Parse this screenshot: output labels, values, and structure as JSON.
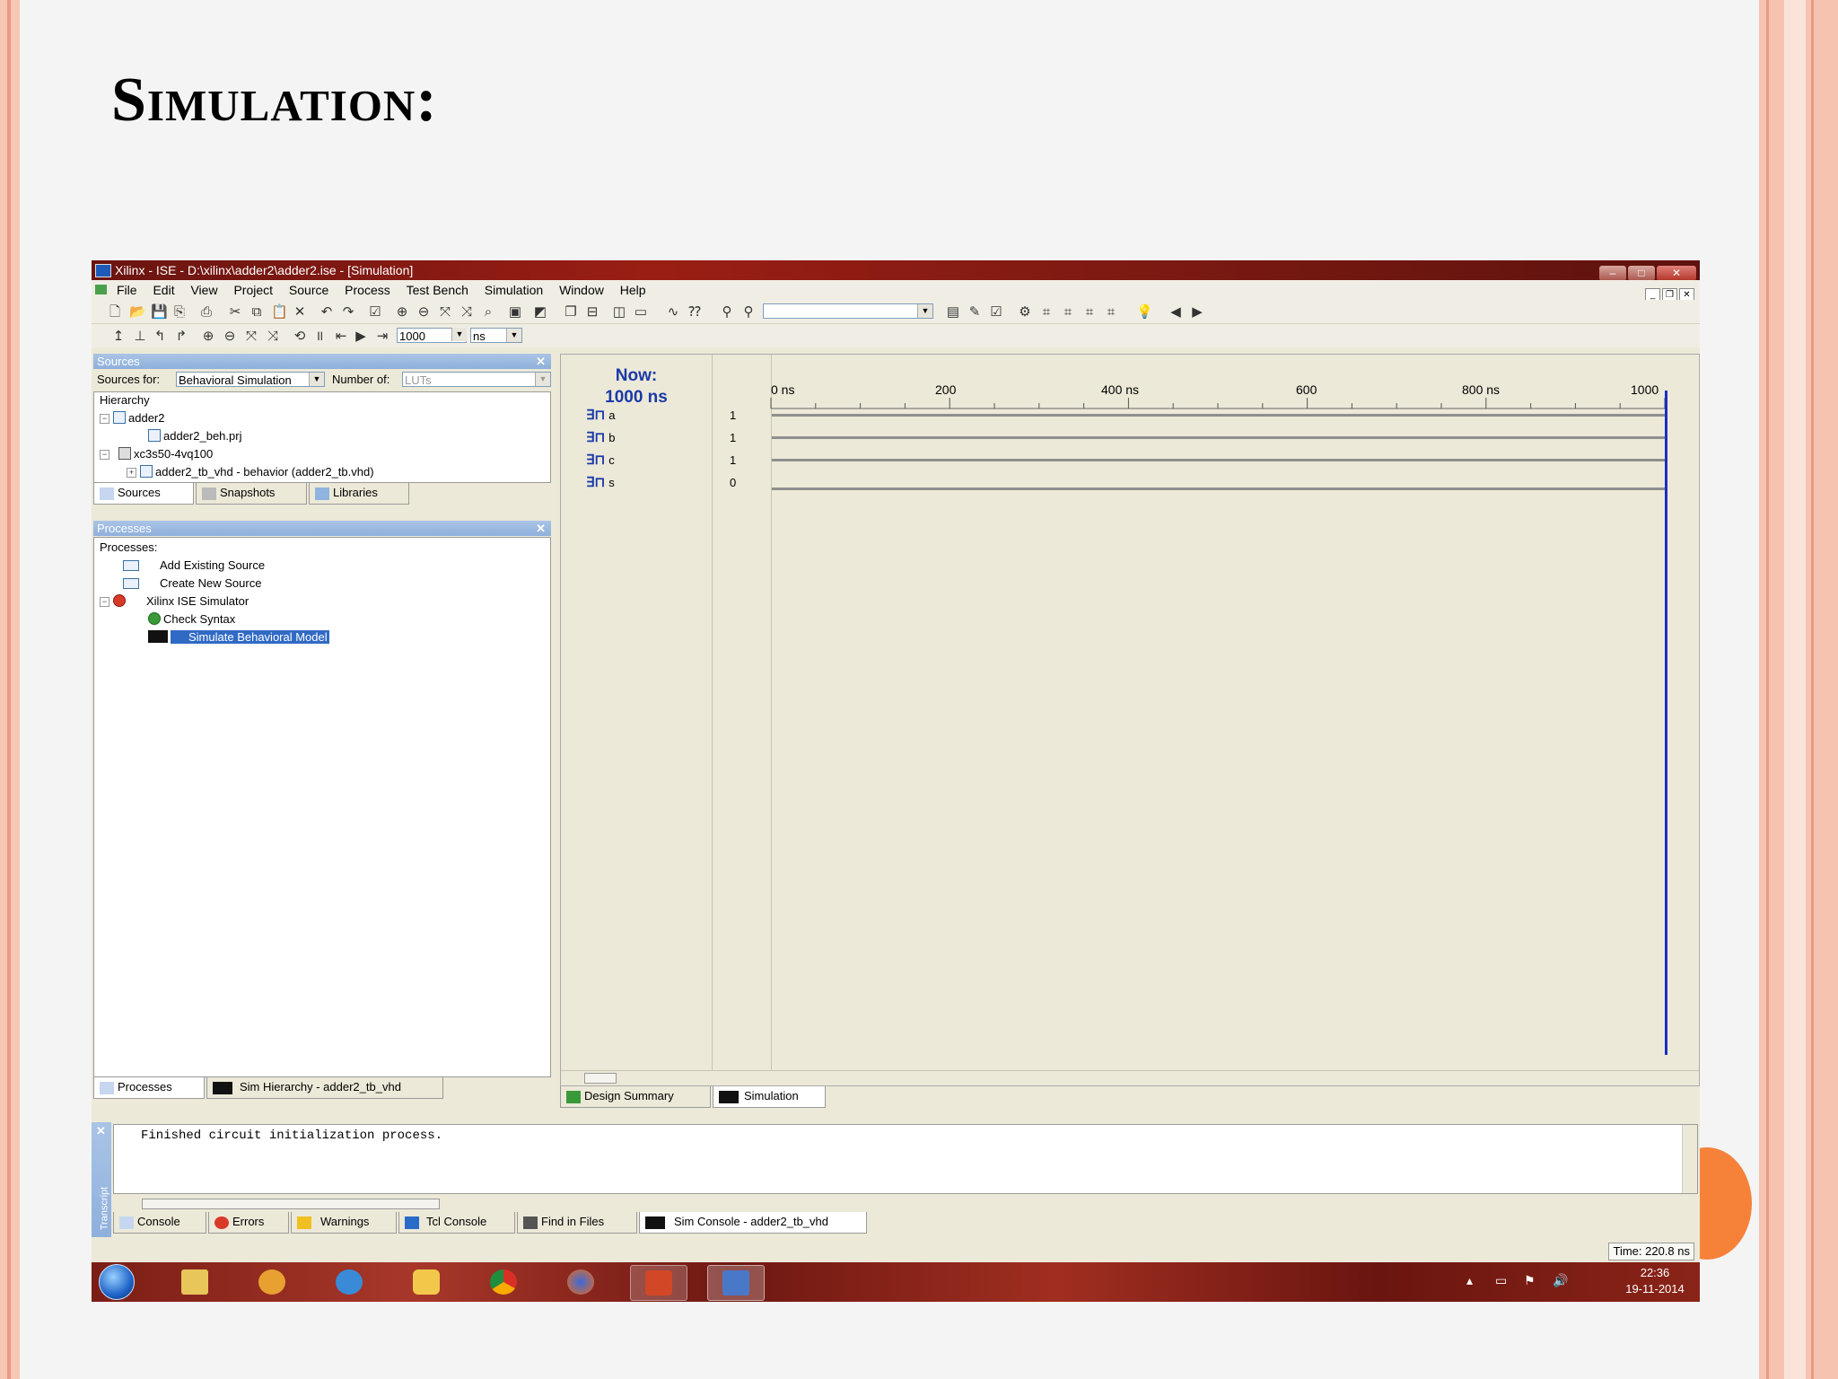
{
  "slide": {
    "title": "Simulation:"
  },
  "window": {
    "title": "Xilinx - ISE - D:\\xilinx\\adder2\\adder2.ise - [Simulation]",
    "controls": {
      "minimize": "–",
      "maximize": "□",
      "close": "✕"
    }
  },
  "menubar": {
    "items": [
      "File",
      "Edit",
      "View",
      "Project",
      "Source",
      "Process",
      "Test Bench",
      "Simulation",
      "Window",
      "Help"
    ]
  },
  "toolbar2": {
    "time_value": "1000",
    "time_unit": "ns"
  },
  "sources_panel": {
    "header": "Sources",
    "sources_for_label": "Sources for:",
    "sources_for_value": "Behavioral Simulation",
    "number_of_label": "Number of:",
    "number_of_value": "LUTs",
    "hierarchy_label": "Hierarchy",
    "tree": [
      {
        "label": "adder2",
        "expander": "−"
      },
      {
        "label": "adder2_beh.prj"
      },
      {
        "label": "xc3s50-4vq100",
        "expander": "−"
      },
      {
        "label": "adder2_tb_vhd - behavior (adder2_tb.vhd)",
        "expander": "+"
      }
    ],
    "tabs": [
      "Sources",
      "Snapshots",
      "Libraries"
    ]
  },
  "processes_panel": {
    "header": "Processes",
    "label": "Processes:",
    "items": [
      "Add Existing Source",
      "Create New Source",
      "Xilinx ISE Simulator",
      "Check Syntax",
      "Simulate Behavioral Model"
    ],
    "tabs": [
      "Processes",
      "Sim Hierarchy - adder2_tb_vhd"
    ]
  },
  "wave": {
    "now_label": "Now:",
    "now_value": "1000 ns",
    "ruler_labels": [
      "0 ns",
      "200",
      "400 ns",
      "600",
      "800 ns",
      "1000"
    ],
    "signals": [
      {
        "name": "a",
        "value": "1"
      },
      {
        "name": "b",
        "value": "1"
      },
      {
        "name": "c",
        "value": "1"
      },
      {
        "name": "s",
        "value": "0"
      }
    ],
    "tabs": [
      "Design Summary",
      "Simulation"
    ]
  },
  "console": {
    "text": "Finished circuit initialization process.",
    "side_label": "Transcript",
    "tabs": [
      "Console",
      "Errors",
      "Warnings",
      "Tcl Console",
      "Find in Files",
      "Sim Console - adder2_tb_vhd"
    ]
  },
  "status": {
    "time": "Time: 220.8 ns"
  },
  "taskbar": {
    "clock_time": "22:36",
    "clock_date": "19-11-2014"
  },
  "colors": {
    "accent_blue": "#1a3aa8",
    "selection": "#316ac5",
    "slide_border": "#f6c3b0",
    "orange_dot": "#f6823a"
  }
}
